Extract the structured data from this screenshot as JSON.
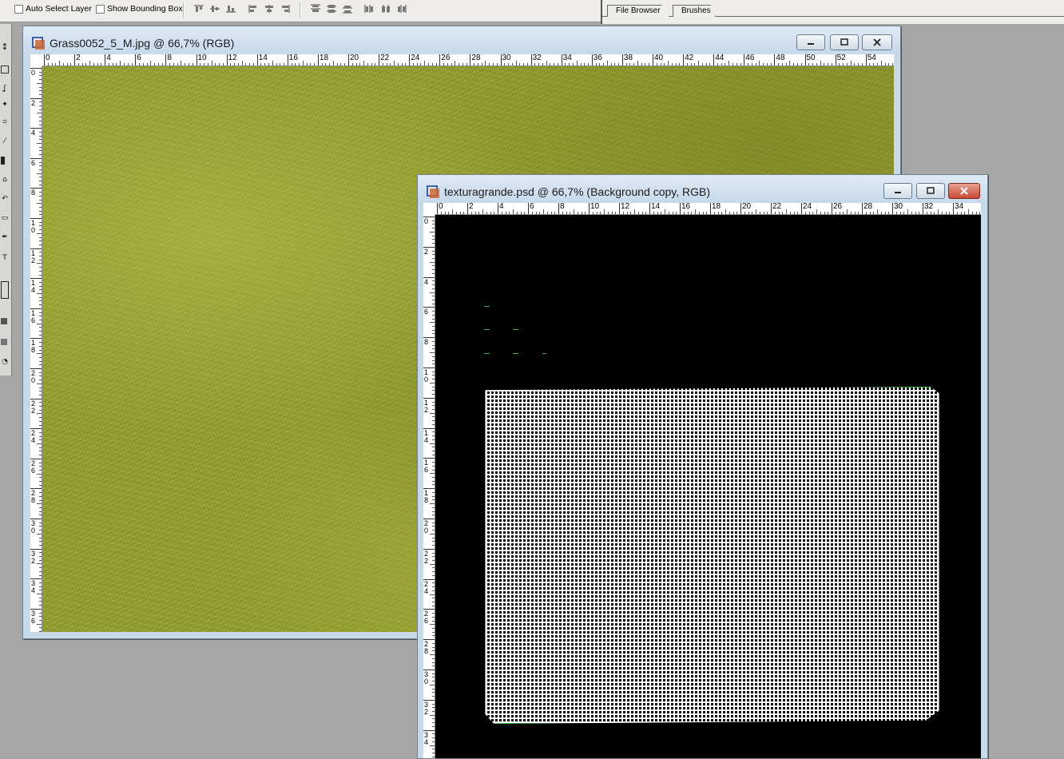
{
  "options_bar": {
    "auto_select_layer": "Auto Select Layer",
    "show_bounding_box": "Show Bounding Box"
  },
  "palette_well": {
    "tabs": [
      "File Browser",
      "Brushes"
    ]
  },
  "windows": {
    "grass": {
      "title": "Grass0052_5_M.jpg @ 66,7% (RGB)",
      "ruler_h": [
        "0",
        "2",
        "4",
        "6",
        "8",
        "10",
        "12",
        "14",
        "16",
        "18",
        "20",
        "22",
        "24",
        "26",
        "28",
        "30",
        "32",
        "34",
        "36",
        "38",
        "40",
        "42",
        "44",
        "46",
        "48",
        "50",
        "52",
        "54",
        "5"
      ],
      "ruler_v": [
        "0",
        "2",
        "4",
        "6",
        "8",
        "1 0",
        "1 2",
        "1 4",
        "1 6",
        "1 8",
        "2 0",
        "2 2",
        "2 4",
        "2 6",
        "2 8",
        "3 0",
        "3 2",
        "3 4",
        "3 6"
      ]
    },
    "textura": {
      "title": "texturagrande.psd @ 66,7% (Background copy, RGB)",
      "ruler_h": [
        "0",
        "2",
        "4",
        "6",
        "8",
        "10",
        "12",
        "14",
        "16",
        "18",
        "20",
        "22",
        "24",
        "26",
        "28",
        "30",
        "32",
        "34"
      ],
      "ruler_v": [
        "0",
        "2",
        "4",
        "6",
        "8",
        "1 0",
        "1 2",
        "1 4",
        "1 6",
        "1 8",
        "2 0",
        "2 2",
        "2 4",
        "2 6",
        "2 8",
        "3 0",
        "3 2",
        "3 4"
      ]
    }
  },
  "colors": {
    "desktop": "#a6a6a6",
    "title_bar": "#c7daea",
    "close_button": "#c74a36",
    "selection_outline": "#4fc24f"
  }
}
